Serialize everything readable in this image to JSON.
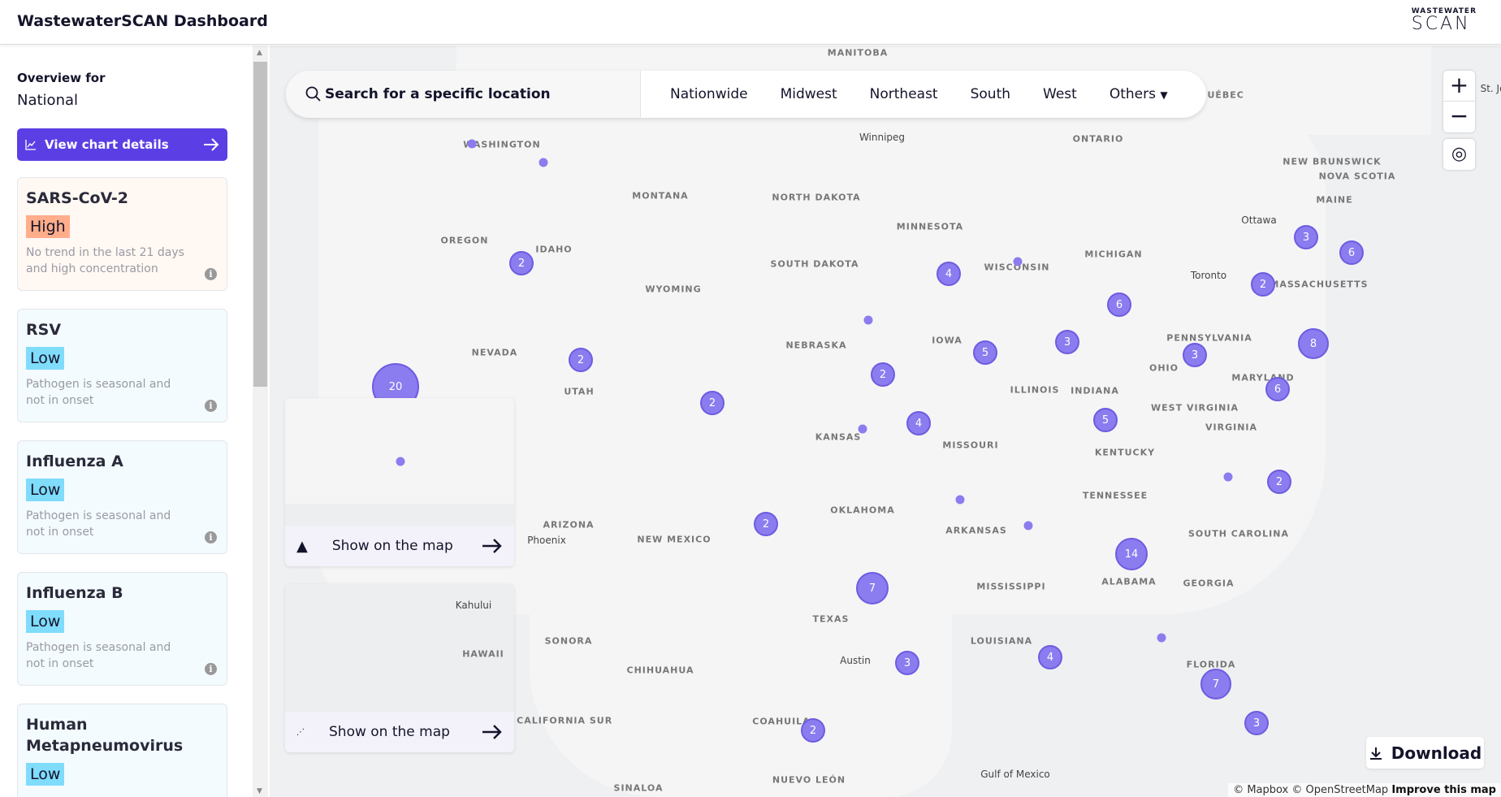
{
  "header": {
    "title": "WastewaterSCAN Dashboard",
    "logo_top": "WASTEWATER",
    "logo_bottom": "SCAN"
  },
  "sidebar": {
    "overview_label": "Overview for",
    "location": "National",
    "view_chart_label": "View chart details",
    "cards": [
      {
        "name": "SARS-CoV-2",
        "level": "High",
        "desc": "No trend in the last 21 days and high concentration"
      },
      {
        "name": "RSV",
        "level": "Low",
        "desc": "Pathogen is seasonal and not in onset"
      },
      {
        "name": "Influenza A",
        "level": "Low",
        "desc": "Pathogen is seasonal and not in onset"
      },
      {
        "name": "Influenza B",
        "level": "Low",
        "desc": "Pathogen is seasonal and not in onset"
      },
      {
        "name": "Human Metapneumovirus",
        "level": "Low",
        "desc": ""
      }
    ]
  },
  "colors": {
    "accent": "#5b3fe4",
    "high": "#ffad8a",
    "low": "#7fdcfb",
    "high_card": "#fff8f3",
    "low_card": "#f3fbff",
    "cluster": "#8b7cf0"
  },
  "search": {
    "placeholder": "Search for a specific location",
    "tabs": [
      "Nationwide",
      "Midwest",
      "Northeast",
      "South",
      "West",
      "Others"
    ]
  },
  "map": {
    "state_labels": [
      "MANITOBA",
      "ONTARIO",
      "QUÉBEC",
      "WASHINGTON",
      "MONTANA",
      "NORTH DAKOTA",
      "MINNESOTA",
      "OREGON",
      "IDAHO",
      "WYOMING",
      "SOUTH DAKOTA",
      "WISCONSIN",
      "MICHIGAN",
      "NEVADA",
      "UTAH",
      "NEBRASKA",
      "IOWA",
      "ILLINOIS",
      "INDIANA",
      "OHIO",
      "PENNSYLVANIA",
      "KANSAS",
      "MISSOURI",
      "KENTUCKY",
      "WEST VIRGINIA",
      "VIRGINIA",
      "MARYLAND",
      "ARIZONA",
      "NEW MEXICO",
      "OKLAHOMA",
      "ARKANSAS",
      "TENNESSEE",
      "SOUTH CAROLINA",
      "TEXAS",
      "MISSISSIPPI",
      "ALABAMA",
      "GEORGIA",
      "LOUISIANA",
      "FLORIDA",
      "SONORA",
      "CHIHUAHUA",
      "COAHUILA",
      "BAJA CALIFORNIA SUR",
      "NUEVO LEÓN",
      "SINALOA",
      "HAWAII",
      "MAINE",
      "NEW BRUNSWICK",
      "NOVA SCOTIA",
      "MASSACHUSETTS"
    ],
    "city_labels": [
      "Winnipeg",
      "Ottawa",
      "Toronto",
      "Phoenix",
      "Austin",
      "Kahului",
      "Gulf of Mexico",
      "St. Jo"
    ],
    "clusters": [
      "20",
      "2",
      "2",
      "2",
      "2",
      "4",
      "5",
      "3",
      "6",
      "4",
      "5",
      "3",
      "2",
      "3",
      "6",
      "8",
      "6",
      "2",
      "2",
      "7",
      "14",
      "3",
      "4",
      "7",
      "3",
      "2"
    ],
    "alaska_label": "Show on the map",
    "hawaii_label": "Show on the map",
    "download_label": "Download",
    "attribution": "© Mapbox © OpenStreetMap",
    "improve": "Improve this map"
  }
}
